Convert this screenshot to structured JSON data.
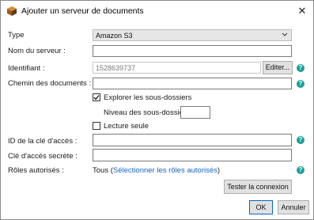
{
  "dialog": {
    "title": "Ajouter un serveur de documents",
    "close_glyph": "✕"
  },
  "form": {
    "type_label": "Type",
    "type_value": "Amazon S3",
    "server_name_label": "Nom du serveur :",
    "server_name_value": "",
    "identifier_label": "Identifiant :",
    "identifier_value": "1528639737",
    "edit_button": "Editer...",
    "doc_path_label": "Chemin des documents :",
    "doc_path_value": "",
    "explore_subfolders_label": "Explorer les sous-dossiers",
    "explore_subfolders_checked": true,
    "subfolder_level_label": "Niveau des sous-dossiers:",
    "subfolder_level_value": "",
    "read_only_label": "Lecture seule",
    "read_only_checked": false,
    "access_key_id_label": "ID de la clé d'accès :",
    "access_key_id_value": "",
    "secret_key_label": "Clé d'accès secrète :",
    "secret_key_value": "",
    "authorized_roles_label": "Rôles autorisés :",
    "authorized_roles_value": "Tous",
    "authorized_roles_open": "(",
    "select_roles_link": "Sélectionner les rôles autorisés",
    "authorized_roles_close": ")"
  },
  "buttons": {
    "test_connection": "Tester la connexion",
    "ok": "OK",
    "cancel": "Annuler"
  },
  "help_glyph": "?",
  "colors": {
    "help_icon": "#1f9e97",
    "link": "#1565c0",
    "button_bg": "#e1e1e1"
  }
}
